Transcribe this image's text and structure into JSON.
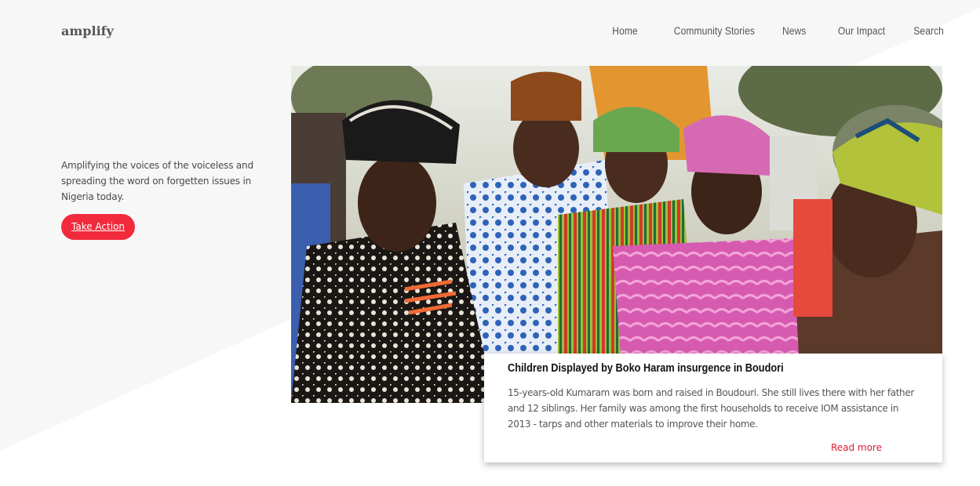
{
  "app": {
    "logo": "amplify"
  },
  "nav": {
    "items": [
      {
        "label": "Home"
      },
      {
        "label": "Community Stories"
      },
      {
        "label": "News"
      },
      {
        "label": "Our Impact"
      },
      {
        "label": "Search"
      }
    ]
  },
  "hero": {
    "tagline": "Amplifying the voices of the voiceless and spreading the word on forgetten issues in Nigeria today.",
    "cta_label": "Take Action"
  },
  "story": {
    "title": "Children Displayed by Boko Haram insurgence in Boudori",
    "excerpt": "15-years-old Kumaram was born and raised in Boudouri. She still lives there with her father and 12 siblings. Her family was among the first households to receive IOM assistance in 2013 - tarps and other materials to improve their home.",
    "read_more": "Read more"
  },
  "colors": {
    "accent": "#f12b3c",
    "link": "#d81e2f",
    "background_shape": "#f6f6f7"
  }
}
